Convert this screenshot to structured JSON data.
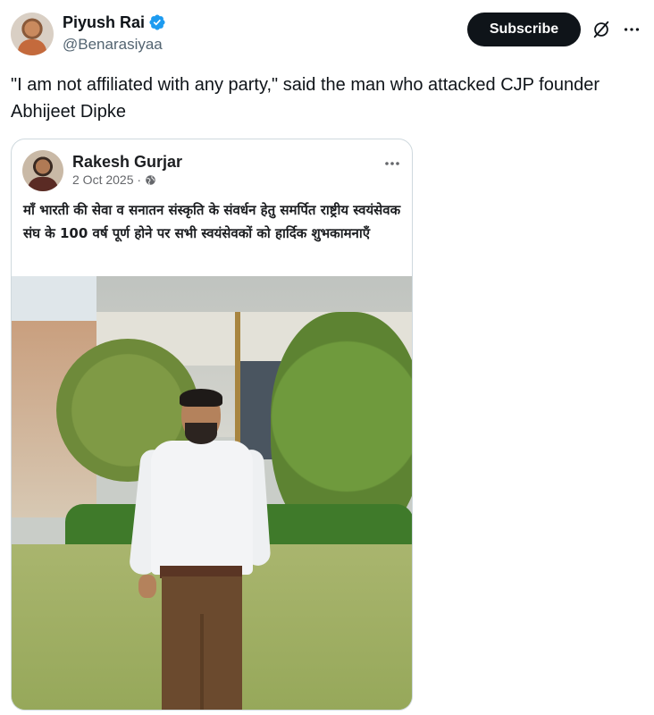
{
  "author": {
    "name": "Piyush Rai",
    "handle": "@Benarasiyaa",
    "verified": true
  },
  "actions": {
    "subscribe_label": "Subscribe",
    "grok_icon": "grok-icon",
    "more_icon": "more-options-icon"
  },
  "tweet": {
    "text": "\"I am not affiliated with any party,\" said the man who attacked CJP founder Abhijeet Dipke"
  },
  "embedded_post": {
    "name": "Rakesh Gurjar",
    "date": "2 Oct 2025 ·",
    "privacy_icon": "globe-icon",
    "text": "माँ भारती की सेवा व सनातन संस्कृति के संवर्धन हेतु समर्पित राष्ट्रीय स्वयंसेवक संघ के 100 वर्ष पूर्ण होने पर सभी स्वयंसेवकों को हार्दिक शुभकामनाएँ"
  },
  "colors": {
    "text": "#0f1419",
    "secondary_text": "#536471",
    "verified_blue": "#1d9bf0",
    "subscribe_bg": "#0f1419",
    "card_border": "#cfd9de"
  }
}
